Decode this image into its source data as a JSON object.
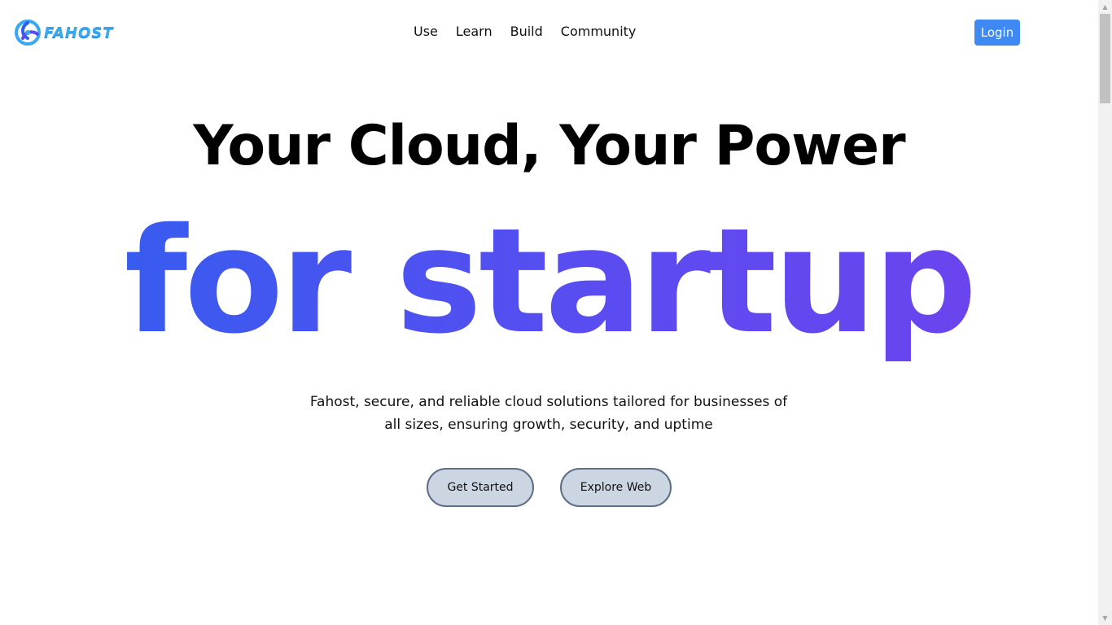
{
  "brand": {
    "name": "FAHOST",
    "logo_icon": "fahost-logo-icon",
    "colors": {
      "text": "#38a8f0",
      "mark_dark": "#2f5ff0",
      "mark_light": "#38a8f0"
    }
  },
  "nav": {
    "items": [
      {
        "label": "Use"
      },
      {
        "label": "Learn"
      },
      {
        "label": "Build"
      },
      {
        "label": "Community"
      }
    ]
  },
  "header": {
    "login_label": "Login",
    "login_color": "#3f89f2"
  },
  "hero": {
    "title": "Your Cloud, Your Power",
    "highlight": "for startup",
    "highlight_gradient": [
      "#2f5ff0",
      "#5a4cf0",
      "#7042ee"
    ],
    "description": "Fahost, secure, and reliable cloud solutions tailored for businesses of all sizes, ensuring growth, security, and uptime",
    "buttons": {
      "get_started": "Get Started",
      "explore_web": "Explore Web"
    }
  },
  "scrollbar": {
    "up_icon": "scroll-up-arrow-icon",
    "down_icon": "scroll-down-arrow-icon"
  }
}
